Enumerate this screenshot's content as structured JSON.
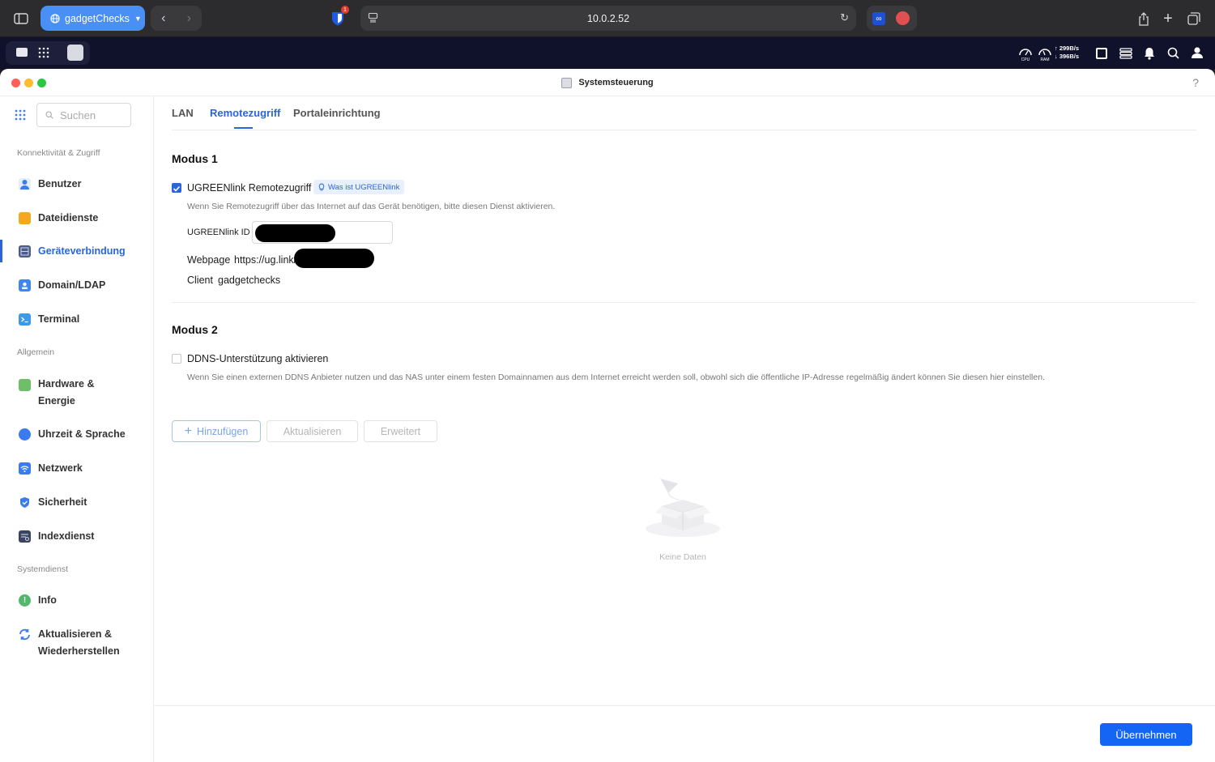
{
  "browser": {
    "tab_group_label": "gadgetChecks",
    "url": "10.0.2.52",
    "bitwarden_badge": "1"
  },
  "nas_bar": {
    "cpu_label": "CPU",
    "ram_label": "RAM",
    "upload_speed": "299B/s",
    "download_speed": "396B/s"
  },
  "window": {
    "title": "Systemsteuerung",
    "help": "?"
  },
  "sidebar": {
    "search_placeholder": "Suchen",
    "sections": [
      {
        "label": "Konnektivität & Zugriff",
        "items": [
          {
            "label": "Benutzer"
          },
          {
            "label": "Dateidienste"
          },
          {
            "label": "Geräteverbindung"
          },
          {
            "label": "Domain/LDAP"
          },
          {
            "label": "Terminal"
          }
        ]
      },
      {
        "label": "Allgemein",
        "items": [
          {
            "label": "Hardware &",
            "label2": "Energie"
          },
          {
            "label": "Uhrzeit & Sprache"
          },
          {
            "label": "Netzwerk"
          },
          {
            "label": "Sicherheit"
          },
          {
            "label": "Indexdienst"
          }
        ]
      },
      {
        "label": "Systemdienst",
        "items": [
          {
            "label": "Info"
          },
          {
            "label": "Aktualisieren &",
            "label2": "Wiederherstellen"
          }
        ]
      }
    ],
    "active_item": "Geräteverbindung"
  },
  "tabs": [
    {
      "label": "LAN"
    },
    {
      "label": "Remotezugriff"
    },
    {
      "label": "Portaleinrichtung"
    }
  ],
  "modus1": {
    "heading": "Modus 1",
    "checkbox_label": "UGREENlink Remotezugriff",
    "checked": true,
    "info_tag": "Was ist UGREENlink",
    "description": "Wenn Sie Remotezugriff über das Internet auf das Gerät benötigen, bitte diesen Dienst aktivieren.",
    "id_label": "UGREENlink ID",
    "webpage_label": "Webpage",
    "webpage_value": "https://ug.link/",
    "client_label": "Client",
    "client_value": "gadgetchecks"
  },
  "modus2": {
    "heading": "Modus 2",
    "checkbox_label": "DDNS-Unterstützung aktivieren",
    "checked": false,
    "description": "Wenn Sie einen externen DDNS Anbieter nutzen und das NAS unter einem festen Domainnamen aus dem Internet erreicht werden soll, obwohl sich die öffentliche IP-Adresse regelmäßig ändert können Sie diesen hier einstellen.",
    "buttons": {
      "add": "Hinzufügen",
      "refresh": "Aktualisieren",
      "advanced": "Erweitert"
    },
    "empty_text": "Keine Daten"
  },
  "footer": {
    "apply": "Übernehmen"
  },
  "colors": {
    "accent": "#2b65d9",
    "apply_button": "#1565f5",
    "tab_group": "#4a8ff5"
  }
}
